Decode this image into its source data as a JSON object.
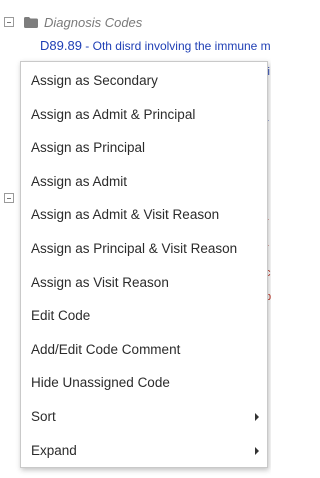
{
  "tree": {
    "title": "Diagnosis Codes",
    "code": "D89.89",
    "description": "Oth disrd involving the immune m"
  },
  "menu": {
    "items": [
      {
        "label": "Assign as Secondary"
      },
      {
        "label": "Assign as Admit & Principal"
      },
      {
        "label": "Assign as Principal"
      },
      {
        "label": "Assign as Admit"
      },
      {
        "label": "Assign as Admit & Visit Reason"
      },
      {
        "label": "Assign as Principal & Visit Reason"
      },
      {
        "label": "Assign as Visit Reason"
      },
      {
        "label": "Edit Code"
      },
      {
        "label": "Add/Edit Code Comment"
      },
      {
        "label": "Hide Unassigned Code"
      },
      {
        "label": "Sort",
        "submenu": true
      },
      {
        "label": "Expand",
        "submenu": true
      }
    ]
  },
  "colors": {
    "code_link": "#1f3fb5",
    "menu_text": "#2b2b2b",
    "tree_title": "#7a7a7a"
  }
}
